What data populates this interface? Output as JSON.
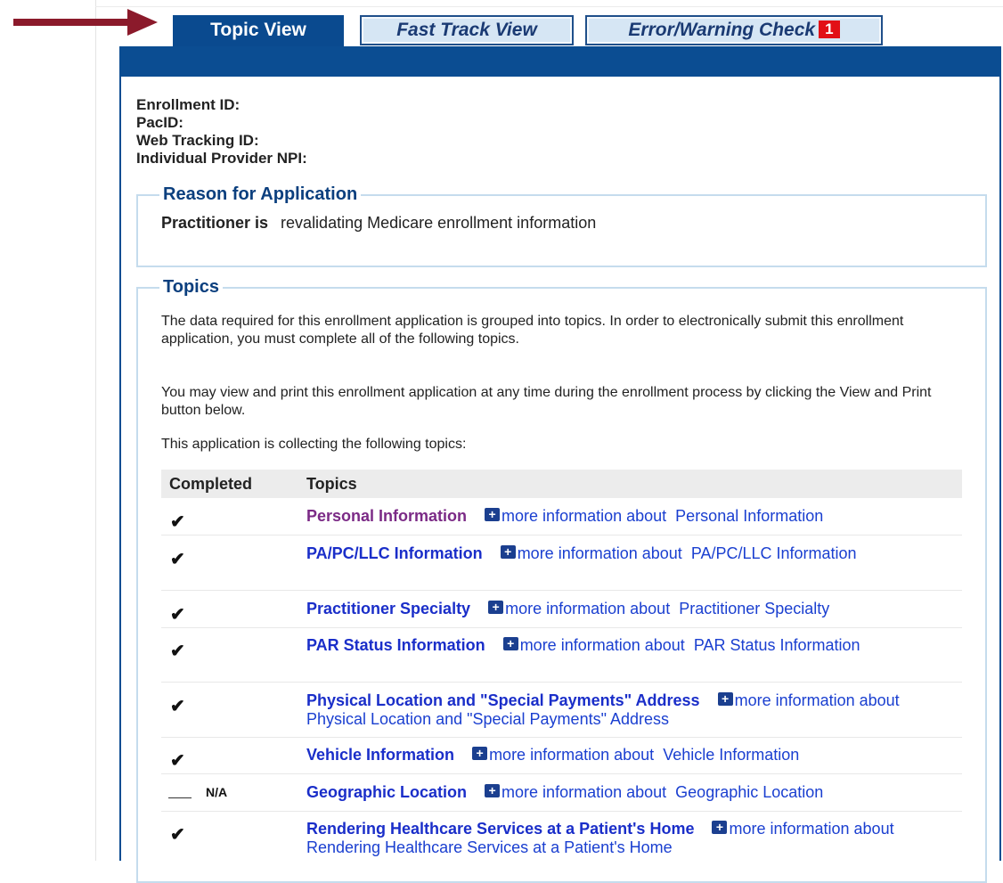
{
  "tabs": {
    "topic_view": "Topic View",
    "fast_track": "Fast Track View",
    "error_check": "Error/Warning Check",
    "error_count": "1"
  },
  "ids": {
    "enrollment": "Enrollment ID:",
    "pac": "PacID:",
    "web_tracking": "Web Tracking ID:",
    "npi": "Individual Provider NPI:"
  },
  "reason": {
    "legend": "Reason for Application",
    "label": "Practitioner is",
    "value": "revalidating Medicare enrollment information"
  },
  "topics": {
    "legend": "Topics",
    "para1": "The data required for this enrollment application is grouped into topics. In order to electronically submit this enrollment application, you must complete all of the following topics.",
    "para2": "You may view and print this enrollment application at any time during the enrollment process by clicking the View and Print button below.",
    "para3": "This application is collecting the following topics:",
    "col_completed": "Completed",
    "col_topics": "Topics",
    "more_prefix": "more information about",
    "rows": [
      {
        "status": "✔",
        "name": "Personal Information"
      },
      {
        "status": "✔",
        "name": "PA/PC/LLC Information"
      },
      {
        "status": "✔",
        "name": "Practitioner Specialty"
      },
      {
        "status": "✔",
        "name": "PAR Status Information"
      },
      {
        "status": "✔",
        "name": "Physical Location and \"Special Payments\" Address"
      },
      {
        "status": "✔",
        "name": "Vehicle Information"
      },
      {
        "status": "N/A",
        "name": "Geographic Location"
      },
      {
        "status": "✔",
        "name": "Rendering Healthcare Services at a Patient's Home"
      }
    ]
  },
  "colors": {
    "brand_blue": "#0b4d92",
    "link_blue": "#1a2ec9",
    "visited_purple": "#7b2a86",
    "error_red": "#e20f16",
    "arrow": "#8b1a2b"
  }
}
